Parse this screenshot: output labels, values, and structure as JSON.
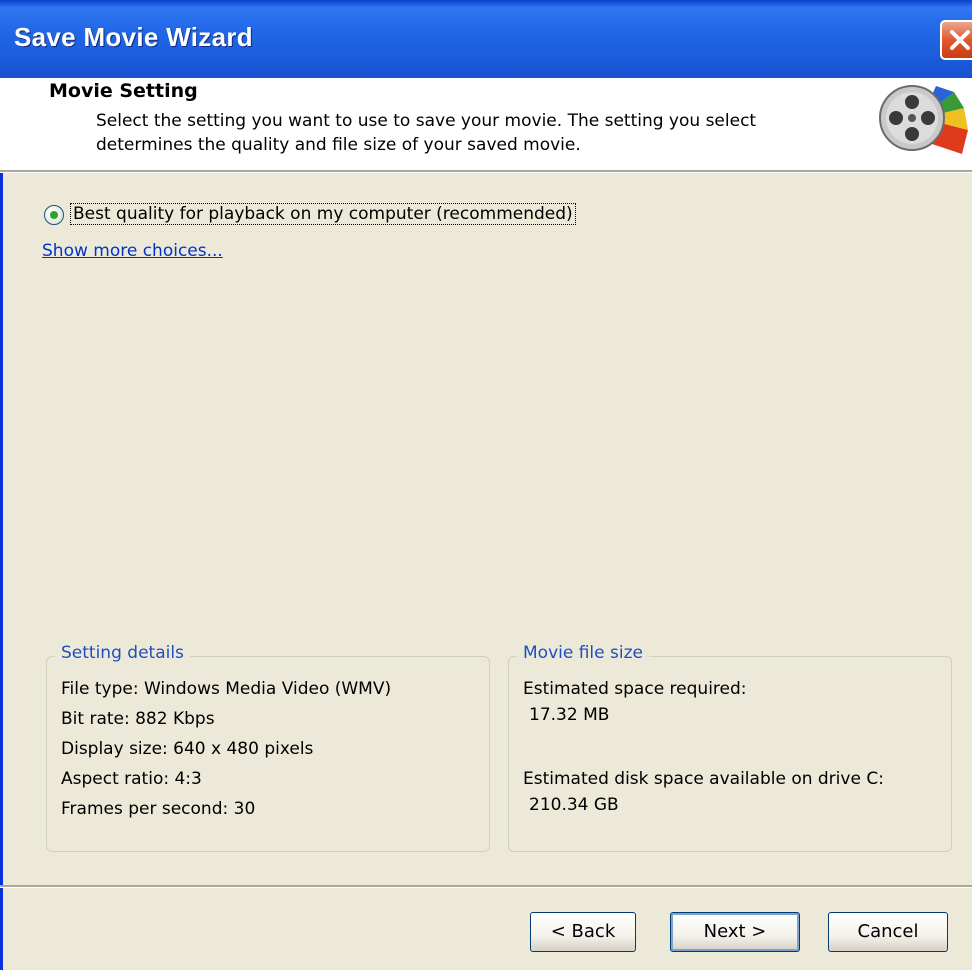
{
  "window": {
    "title": "Save Movie Wizard"
  },
  "header": {
    "title": "Movie Setting",
    "description": "Select the setting you want to use to save your movie. The setting you select determines the quality and file size of your saved movie."
  },
  "options": {
    "selected_label": "Best quality for playback on my computer (recommended)",
    "more_link": "Show more choices..."
  },
  "setting_details": {
    "title": "Setting details",
    "lines": [
      "File type: Windows Media Video (WMV)",
      "Bit rate: 882 Kbps",
      "Display size: 640 x 480 pixels",
      "Aspect ratio: 4:3",
      "Frames per second: 30"
    ]
  },
  "file_size": {
    "title": "Movie file size",
    "required_label": "Estimated space required:",
    "required_value": "17.32 MB",
    "available_label": "Estimated disk space available on drive C:",
    "available_value": "210.34 GB"
  },
  "buttons": {
    "back": "< Back",
    "next": "Next >",
    "cancel": "Cancel"
  },
  "colors": {
    "titlebar": "#2167e6",
    "group_title": "#1f4fbf",
    "link": "#0033cc",
    "close": "#e1582f"
  }
}
